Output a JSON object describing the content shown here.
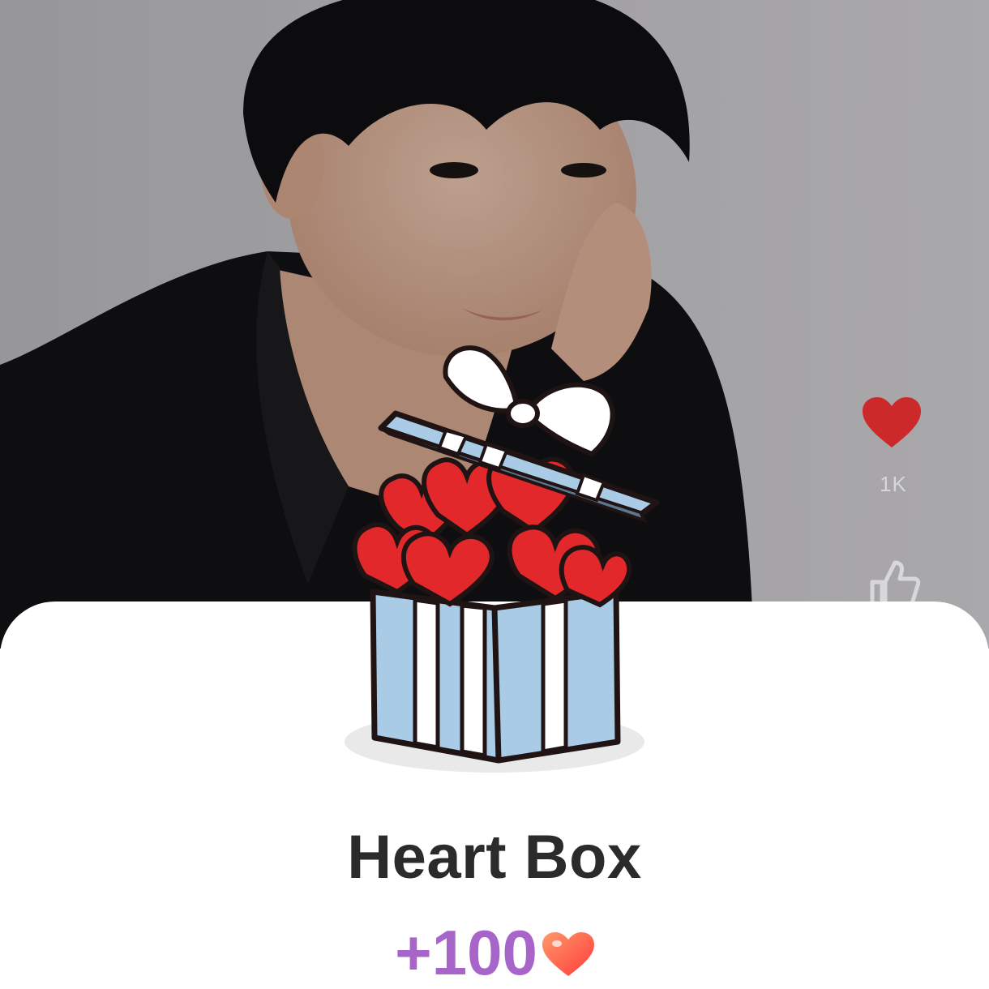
{
  "video": {
    "like_count": "1K",
    "photo_icon": "person-portrait"
  },
  "side_actions": {
    "heart_icon": "heart-icon",
    "thumb_icon": "thumbs-up-icon"
  },
  "reward_card": {
    "title": "Heart Box",
    "amount": "+100",
    "amount_icon": "heart-icon",
    "illustration": "open-gift-box-with-hearts"
  },
  "colors": {
    "title": "#2b2b2b",
    "amount": "#a865c9",
    "heart_red": "#e2282b",
    "box_blue": "#a9cbe6"
  }
}
